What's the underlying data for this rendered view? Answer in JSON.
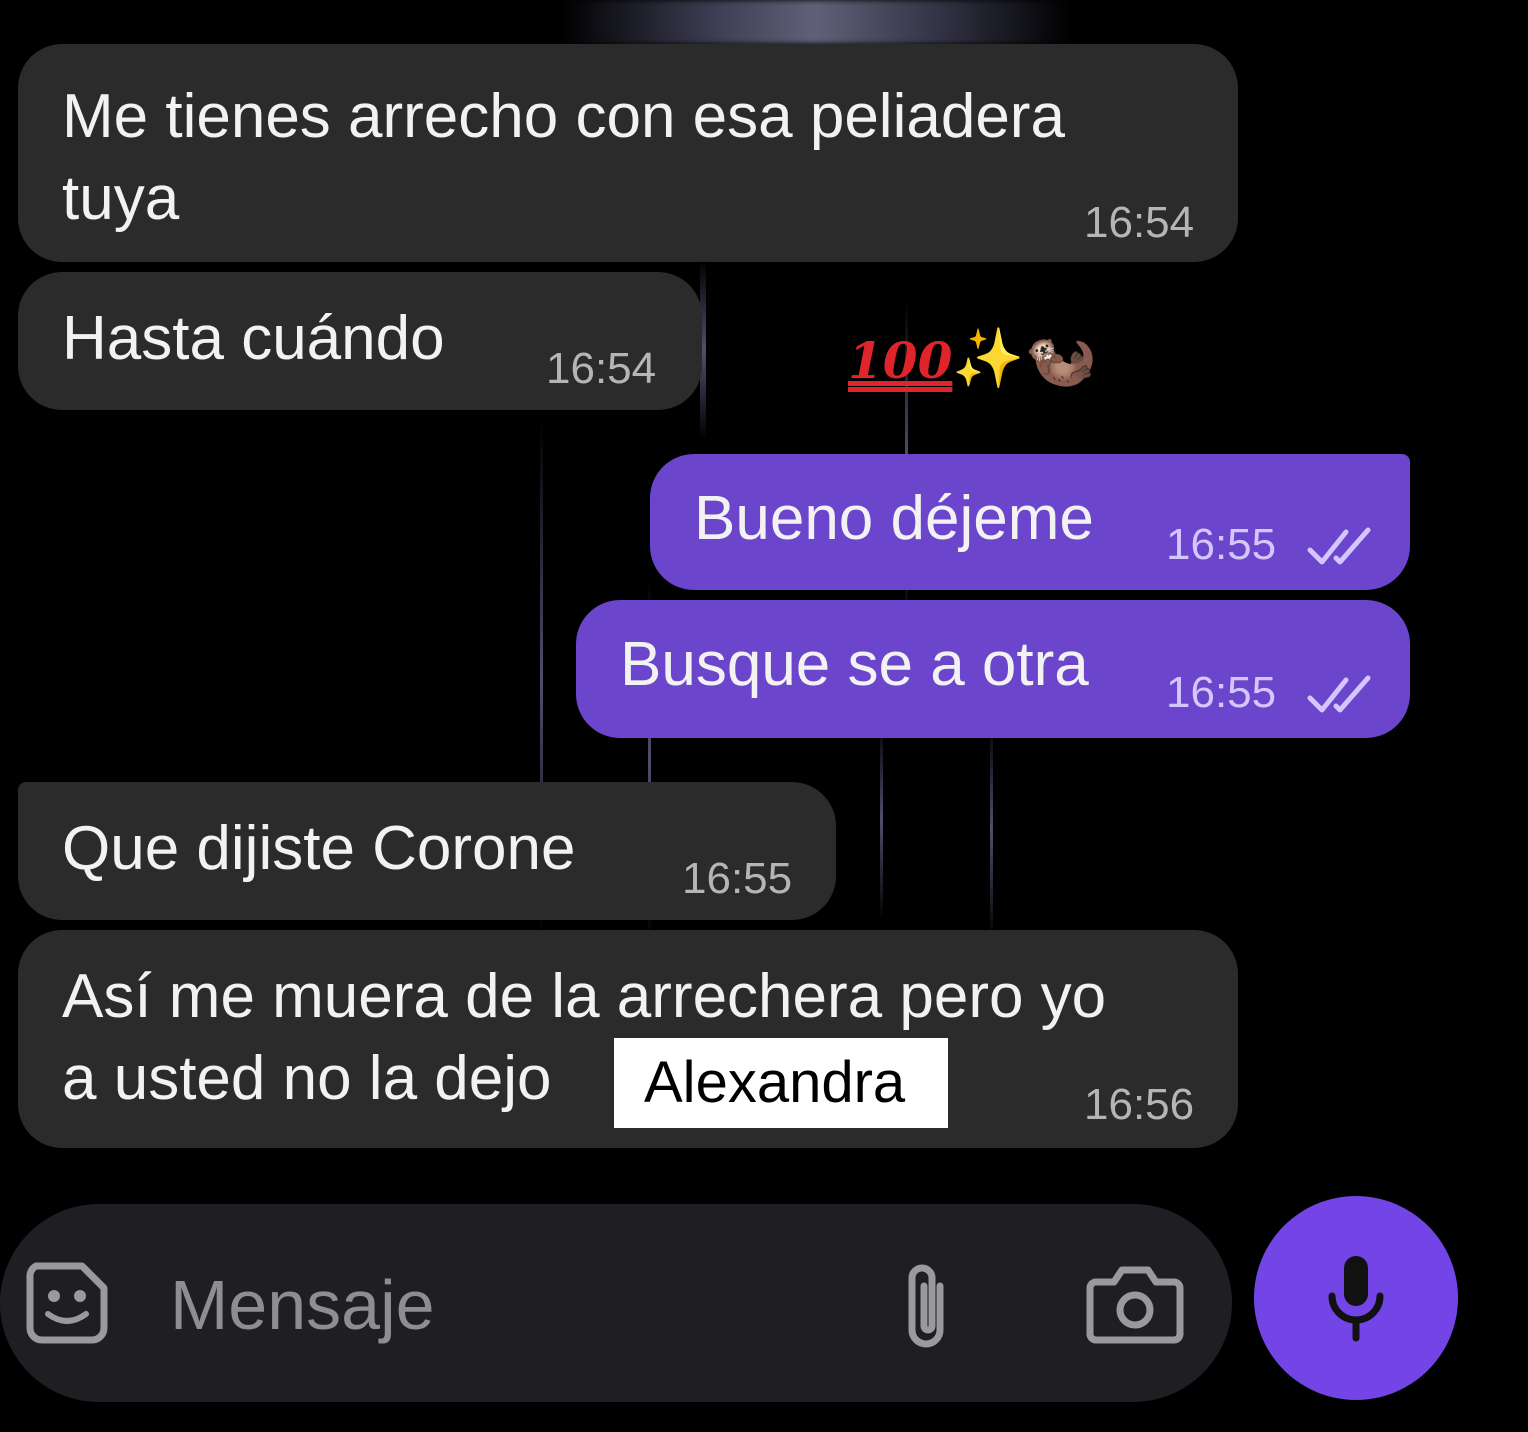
{
  "chat": {
    "messages": [
      {
        "direction": "incoming",
        "text": "Me tienes arrecho con esa peliadera\ntuya",
        "time": "16:54"
      },
      {
        "direction": "incoming",
        "text": "Hasta cuándo",
        "time": "16:54"
      },
      {
        "direction": "outgoing",
        "text": "Bueno déjeme",
        "time": "16:55",
        "status": "read"
      },
      {
        "direction": "outgoing",
        "text": "Busque se a otra",
        "time": "16:55",
        "status": "read"
      },
      {
        "direction": "incoming",
        "text": "Que dijiste Corone",
        "time": "16:55"
      },
      {
        "direction": "incoming",
        "text": "Así me muera de la arrechera pero yo\na usted no la dejo",
        "time": "16:56"
      }
    ],
    "overlay_label": "Alexandra",
    "sticker_emojis": [
      "100-emoji",
      "sparkles-emoji",
      "otter-emoji"
    ]
  },
  "composer": {
    "placeholder": "Mensaje",
    "icons": [
      "sticker-icon",
      "attach-icon",
      "camera-icon",
      "microphone-icon"
    ]
  },
  "colors": {
    "background": "#000000",
    "incoming_bubble": "#2b2b2b",
    "outgoing_bubble": "#6b45cc",
    "accent": "#7345e6",
    "composer": "#1f1f23"
  }
}
